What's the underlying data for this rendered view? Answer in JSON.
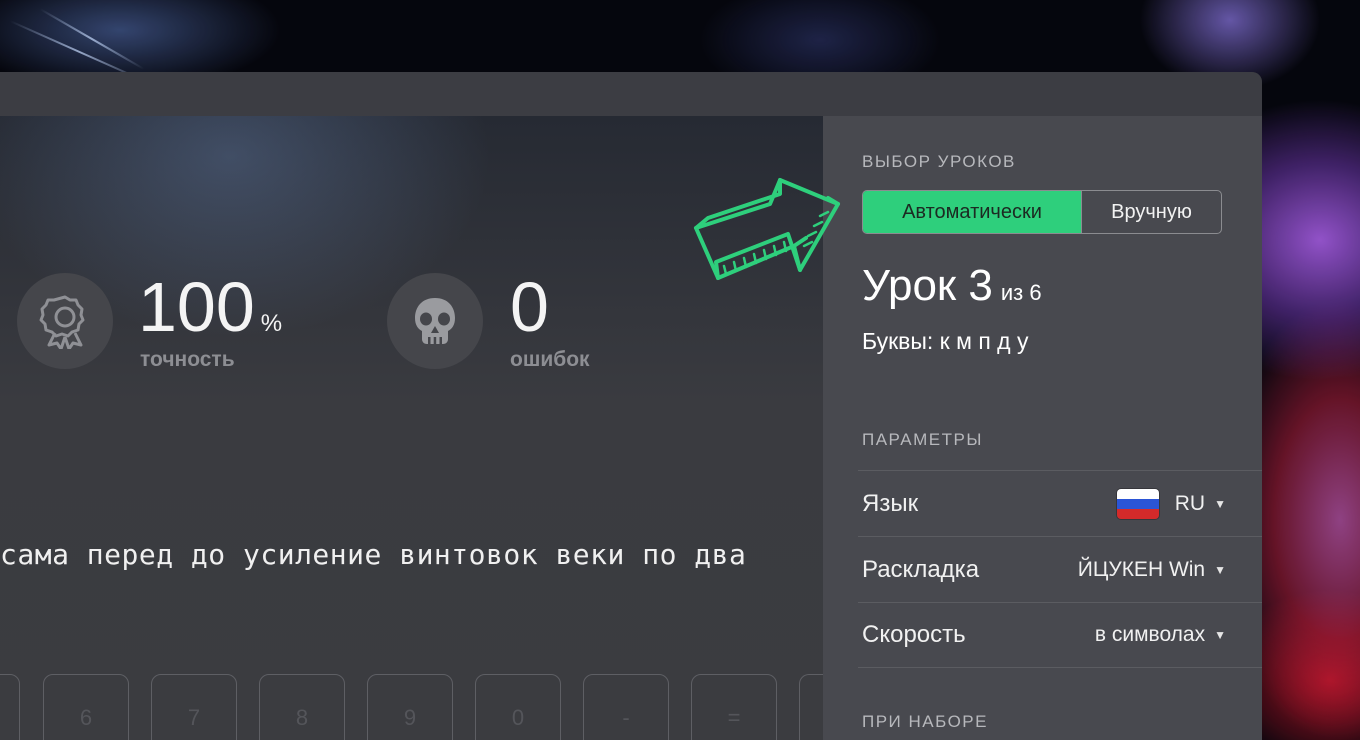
{
  "stats": {
    "accuracy": {
      "value": "100",
      "unit": "%",
      "label": "точность",
      "icon": "medal-icon"
    },
    "errors": {
      "value": "0",
      "label": "ошибок",
      "icon": "skull-icon"
    }
  },
  "typing": {
    "text": "сама перед до усиление винтовок веки по два"
  },
  "keyboard": {
    "keys": [
      "6",
      "7",
      "8",
      "9",
      "0",
      "-",
      "="
    ]
  },
  "sidebar": {
    "lesson_selection": {
      "title": "ВЫБОР УРОКОВ",
      "auto_label": "Автоматически",
      "manual_label": "Вручную",
      "selected": "Автоматически"
    },
    "lesson": {
      "title": "Урок 3",
      "of": "из 6",
      "letters": "Буквы: к м п д у"
    },
    "params": {
      "title": "ПАРАМЕТРЫ",
      "language_label": "Язык",
      "language_value": "RU",
      "layout_label": "Раскладка",
      "layout_value": "ЙЦУКЕН Win",
      "speed_label": "Скорость",
      "speed_value": "в символах"
    },
    "typing_section": {
      "title": "ПРИ НАБОРЕ"
    }
  },
  "colors": {
    "accent": "#2ecf7c",
    "sidebar_bg": "#48494f",
    "titlebar_bg": "#3c3d43"
  }
}
